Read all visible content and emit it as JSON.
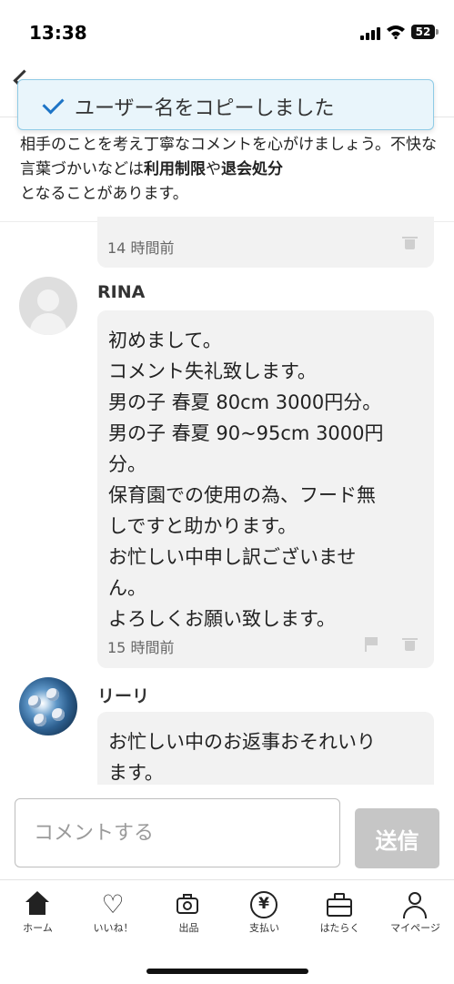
{
  "status_bar": {
    "time": "13:38",
    "battery": "52"
  },
  "toast": {
    "message": "ユーザー名をコピーしました"
  },
  "notice": {
    "text_before": "相手のことを考え丁寧なコメントを心がけましょう。不快な言葉づかいなどは",
    "bold_1": "利用制限",
    "text_mid": "や",
    "bold_2": "退会処分",
    "text_after": "となることがあります。"
  },
  "comments": [
    {
      "time": "14 時間前"
    },
    {
      "username": "RINA",
      "lines": [
        "初めまして。",
        "コメント失礼致します。",
        "男の子 春夏 80cm 3000円分。",
        "男の子 春夏 90~95cm 3000円",
        "分。",
        "保育園での使用の為、フード無",
        "しですと助かります。",
        "お忙しい中申し訳ございませ",
        "ん。",
        "よろしくお願い致します。"
      ],
      "time": "15 時間前"
    },
    {
      "username": "リーリ",
      "lines": [
        "お忙しい中のお返事おそれいり",
        "ます。"
      ]
    }
  ],
  "composer": {
    "placeholder": "コメントする",
    "send_label": "送信"
  },
  "tab_bar": {
    "items": [
      {
        "label": "ホーム",
        "icon": "home-icon"
      },
      {
        "label": "いいね！",
        "icon": "heart-icon"
      },
      {
        "label": "出品",
        "icon": "camera-icon"
      },
      {
        "label": "支払い",
        "icon": "yen-icon"
      },
      {
        "label": "はたらく",
        "icon": "briefcase-icon"
      },
      {
        "label": "マイページ",
        "icon": "person-icon"
      }
    ]
  },
  "colors": {
    "toast_bg": "#e9f5fb",
    "toast_border": "#8fcbe6",
    "check": "#1d74c6",
    "send_disabled": "#c6c6c6"
  }
}
